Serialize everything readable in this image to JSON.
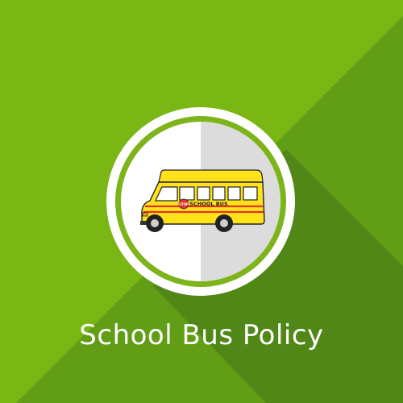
{
  "title": "School Bus Policy",
  "bus_text": "SCHOOL BUS",
  "stop_sign_text": "STOP",
  "icons": [
    "school-bus-icon",
    "stop-sign-icon"
  ],
  "colors": {
    "background_light": "#7ab614",
    "background_dark": "#619e16",
    "shadow": "#4f8218",
    "ring": "#7cb41a",
    "disc_light": "#ffffff",
    "disc_shade": "#dcdcdc",
    "bus_body": "#ffe21a",
    "bus_stripe": "#e4322b",
    "caption": "#ffffff"
  }
}
